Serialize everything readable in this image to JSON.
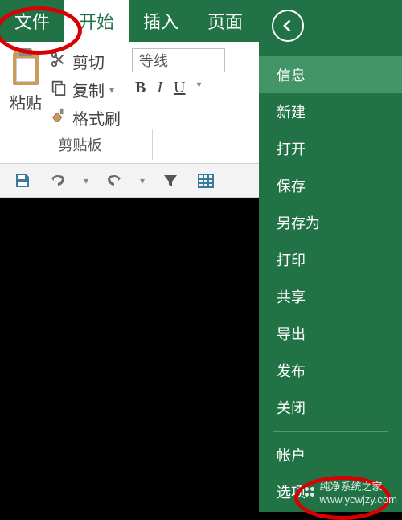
{
  "tabs": {
    "file": "文件",
    "home": "开始",
    "insert": "插入",
    "page": "页面"
  },
  "clipboard": {
    "paste": "粘贴",
    "cut": "剪切",
    "copy": "复制",
    "formatPainter": "格式刷",
    "groupLabel": "剪贴板"
  },
  "font": {
    "name": "等线",
    "bold": "B",
    "italic": "I",
    "underline": "U"
  },
  "fileMenu": {
    "info": "信息",
    "new": "新建",
    "open": "打开",
    "save": "保存",
    "saveAs": "另存为",
    "print": "打印",
    "share": "共享",
    "export": "导出",
    "publish": "发布",
    "close": "关闭",
    "account": "帐户",
    "options": "选项"
  },
  "watermark": {
    "line1": "纯净系统之家",
    "line2": "www.ycwjzy.com"
  }
}
